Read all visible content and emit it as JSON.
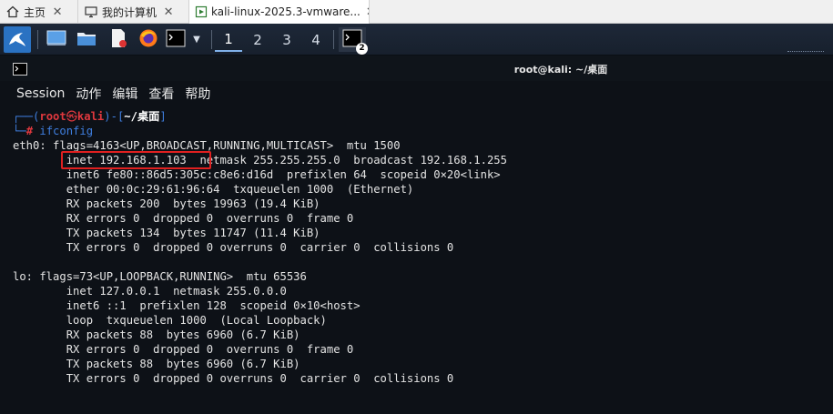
{
  "host_tabs": [
    {
      "label": "主页",
      "icon": "home-icon"
    },
    {
      "label": "我的计算机",
      "icon": "computer-icon"
    },
    {
      "label": "kali-linux-2025.3-vmware...",
      "icon": "vm-icon",
      "active": true
    }
  ],
  "panel": {
    "workspaces": [
      "1",
      "2",
      "3",
      "4"
    ],
    "active_workspace": "1",
    "terminal_badge": "2"
  },
  "window": {
    "title": "root@kali: ~/桌面"
  },
  "menu": [
    "Session",
    "动作",
    "编辑",
    "查看",
    "帮助"
  ],
  "prompt": {
    "user": "root",
    "at_glyph": "㉿",
    "host": "kali",
    "path": "~/桌面",
    "command": "ifconfig"
  },
  "output": [
    "eth0: flags=4163<UP,BROADCAST,RUNNING,MULTICAST>  mtu 1500",
    "        inet 192.168.1.103  netmask 255.255.255.0  broadcast 192.168.1.255",
    "        inet6 fe80::86d5:305c:c8e6:d16d  prefixlen 64  scopeid 0×20<link>",
    "        ether 00:0c:29:61:96:64  txqueuelen 1000  (Ethernet)",
    "        RX packets 200  bytes 19963 (19.4 KiB)",
    "        RX errors 0  dropped 0  overruns 0  frame 0",
    "        TX packets 134  bytes 11747 (11.4 KiB)",
    "        TX errors 0  dropped 0 overruns 0  carrier 0  collisions 0",
    "",
    "lo: flags=73<UP,LOOPBACK,RUNNING>  mtu 65536",
    "        inet 127.0.0.1  netmask 255.0.0.0",
    "        inet6 ::1  prefixlen 128  scopeid 0×10<host>",
    "        loop  txqueuelen 1000  (Local Loopback)",
    "        RX packets 88  bytes 6960 (6.7 KiB)",
    "        RX errors 0  dropped 0  overruns 0  frame 0",
    "        TX packets 88  bytes 6960 (6.7 KiB)",
    "        TX errors 0  dropped 0 overruns 0  carrier 0  collisions 0"
  ],
  "colors": {
    "accent_blue": "#3f7fe0",
    "prompt_red": "#e0383e",
    "highlight_box": "#e02020",
    "terminal_bg": "#0d1117"
  }
}
